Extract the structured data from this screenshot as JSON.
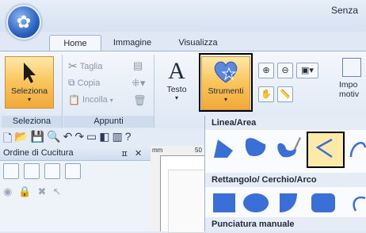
{
  "window": {
    "title": "Senza"
  },
  "tabs": [
    {
      "label": "Home"
    },
    {
      "label": "Immagine"
    },
    {
      "label": "Visualizza"
    }
  ],
  "ribbon": {
    "seleziona": {
      "button_label": "Seleziona",
      "group_label": "Seleziona"
    },
    "appunti": {
      "taglia": "Taglia",
      "copia": "Copia",
      "incolla": "Incolla",
      "group_label": "Appunti"
    },
    "testo": {
      "glyph": "A",
      "label": "Testo"
    },
    "strumenti": {
      "label": "Strumenti"
    },
    "impo": {
      "label_line1": "Impo",
      "label_line2": "motiv"
    }
  },
  "panel": {
    "title": "Ordine di Cucitura",
    "pin_icon": "pin-icon",
    "close_icon": "close-icon"
  },
  "ruler": {
    "mm_label": "mm",
    "tick_label": "50"
  },
  "dropdown": {
    "sections": [
      {
        "label": "Linea/Area"
      },
      {
        "label": "Rettangolo/ Cerchio/Arco"
      },
      {
        "label": "Punciatura manuale"
      }
    ]
  },
  "colors": {
    "accent": "#3a6fd8",
    "select": "#f9c45a",
    "ribbon": "#dde7f4"
  }
}
